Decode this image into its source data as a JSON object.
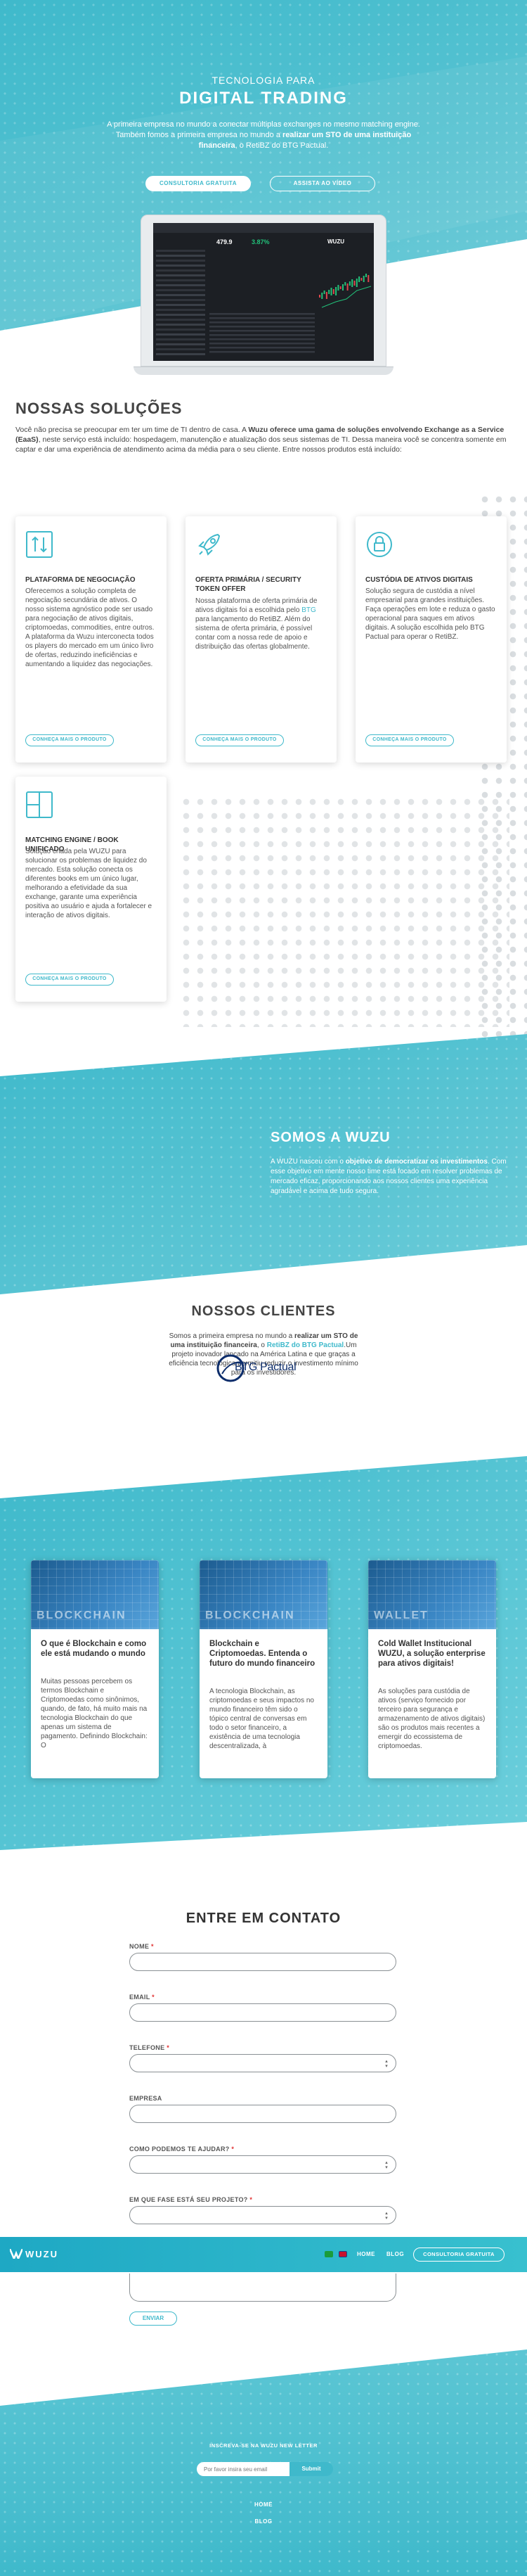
{
  "hero": {
    "eyebrow": "TECNOLOGIA PARA",
    "title": "DIGITAL TRADING",
    "desc_1": "A primeira empresa no mundo a conectar múltiplas exchanges no mesmo matching engine. Também fomos a primeira empresa no mundo a ",
    "desc_bold": "realizar um STO de uma instituição financeira",
    "desc_2": ", o RetiBZ do BTG Pactual.",
    "btn_quote": "CONSULTORIA GRATUITA",
    "btn_video": "ASSISTA AO VÍDEO"
  },
  "laptop_screen": {
    "price_a": "479.9",
    "price_b": "3.87%",
    "brand": "WUZU"
  },
  "solutions": {
    "title": "NOSSAS SOLUÇÕES",
    "intro_1": "Você não precisa se preocupar em ter um time de TI dentro de casa. A ",
    "intro_bold": "Wuzu oferece uma gama de soluções envolvendo Exchange as a Service (EaaS)",
    "intro_2": ", neste serviço está incluído: hospedagem, manutenção e atualização dos seus sistemas de TI. Dessa maneira você se concentra somente em captar e dar uma experiência de atendimento acima da média para o seu cliente. Entre nossos produtos está incluído:",
    "cards": [
      {
        "icon": "trade-arrows-icon",
        "title": "PLATAFORMA DE NEGOCIAÇÃO",
        "text": "Oferecemos a solução completa de negociação secundária de ativos. O nosso sistema agnóstico pode ser usado para negociação de ativos digitais, criptomoedas, commodities, entre outros. A plataforma da Wuzu interconecta todos os players do mercado em um único livro de ofertas, reduzindo ineficiências e aumentando a liquidez das negociações.",
        "button": "CONHEÇA MAIS O PRODUTO"
      },
      {
        "icon": "rocket-icon",
        "title": "OFERTA PRIMÁRIA / SECURITY TOKEN OFFER",
        "text_1": "Nossa plataforma de oferta primária de ativos digitais foi a escolhida pelo ",
        "text_link": "BTG",
        "text_2": " para lançamento do RetiBZ. Além do sistema de oferta primária, é possível contar com a nossa rede de apoio e distribuição das ofertas globalmente.",
        "button": "CONHEÇA MAIS O PRODUTO"
      },
      {
        "icon": "lock-shield-icon",
        "title": "CUSTÓDIA DE ATIVOS DIGITAIS",
        "text": "Solução segura de custódia a nível empresarial para grandes instituições. Faça operações em lote e reduza o gasto operacional para saques em ativos digitais. A solução escolhida pelo BTG Pactual para operar o RetiBZ.",
        "button": "CONHEÇA MAIS O PRODUTO"
      },
      {
        "icon": "matching-engine-icon",
        "title": "MATCHING ENGINE / BOOK UNIFICADO",
        "text": "Solução criada pela WUZU para solucionar os problemas de liquidez do mercado. Esta solução conecta os diferentes books em um único lugar, melhorando a efetividade da sua exchange, garante uma experiência positiva ao usuário e ajuda a fortalecer e interação de ativos digitais.",
        "button": "CONHEÇA MAIS O PRODUTO"
      }
    ]
  },
  "about": {
    "title": "SOMOS A WUZU",
    "text_1": "A WUZU nasceu com o ",
    "text_bold": "objetivo de democratizar os investimentos",
    "text_2": ". Com esse objetivo em mente nosso time está focado em resolver problemas de mercado eficaz, proporcionando aos nossos clientes uma experiência agradável e acima de tudo segura."
  },
  "clients": {
    "title": "NOSSOS CLIENTES",
    "text_1": "Somos a primeira empresa no mundo a ",
    "text_bold": "realizar um STO de uma instituição financeira",
    "text_2": ", o ",
    "text_link": "RetiBZ do BTG Pactual",
    "text_3": ".Um projeto inovador lançado na América Latina e que graças a eficiência tecnológica permitiu reduzir o investimento mínimo para os investidores.",
    "logo_text": "BTG Pactual"
  },
  "blog": {
    "posts": [
      {
        "image_word": "BLOCKCHAIN",
        "title": "O que é Blockchain e como ele está mudando o mundo",
        "text": "Muitas pessoas percebem os termos Blockchain e Criptomoedas como sinônimos, quando, de fato, há muito mais na tecnologia Blockchain do que apenas um sistema de pagamento. Definindo Blockchain: O"
      },
      {
        "image_word": "BLOCKCHAIN",
        "title": "Blockchain e Criptomoedas. Entenda o futuro do mundo financeiro",
        "text": "A tecnologia Blockchain, as criptomoedas e seus impactos no mundo financeiro têm sido o tópico central de conversas em todo o setor financeiro, a existência de uma tecnologia descentralizada, à"
      },
      {
        "image_word": "WALLET",
        "title": "Cold Wallet Institucional WUZU, a solução enterprise para ativos digitais!",
        "text": "As soluções para custódia de ativos (serviço fornecido por terceiro para segurança e armazenamento de ativos digitais) são os produtos mais recentes a emergir do ecossistema de criptomoedas."
      }
    ]
  },
  "contact": {
    "title": "ENTRE EM CONTATO",
    "fields": [
      {
        "label": "NOME",
        "required": "*"
      },
      {
        "label": "EMAIL",
        "required": "*"
      },
      {
        "label": "TELEFONE",
        "required": "*"
      },
      {
        "label": "EMPRESA",
        "required": ""
      },
      {
        "label": "COMO PODEMOS TE AJUDAR?",
        "required": "*"
      },
      {
        "label": "EM QUE FASE ESTÁ SEU PROJETO?",
        "required": "*"
      }
    ],
    "send": "ENVIAR"
  },
  "nav": {
    "logo": "WUZU",
    "home": "HOME",
    "blog": "BLOG",
    "cta": "CONSULTORIA GRATUITA"
  },
  "footer": {
    "newsletter_label": "INSCREVA-SE NA WUZU NEW LETTER",
    "newsletter_placeholder": "Por favor insira seu email",
    "submit": "Submit",
    "link_home": "HOME",
    "link_blog": "BLOG"
  },
  "colors": {
    "accent": "#3fb9cb",
    "nav": "#1ea8c4",
    "text_dark": "#444444"
  }
}
